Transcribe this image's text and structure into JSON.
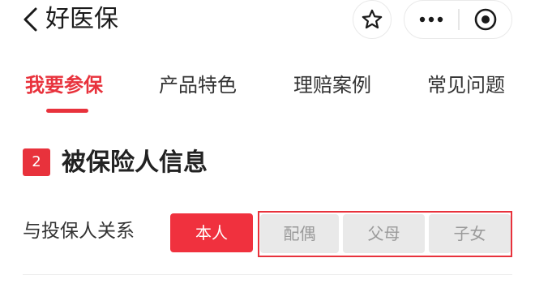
{
  "nav": {
    "title": "好医保",
    "icons": {
      "back": "chevron-left-icon",
      "favorite": "star-icon",
      "more": "more-dots-icon",
      "close": "target-circle-icon"
    }
  },
  "tabs": [
    {
      "label": "我要参保",
      "active": true
    },
    {
      "label": "产品特色",
      "active": false
    },
    {
      "label": "理赔案例",
      "active": false
    },
    {
      "label": "常见问题",
      "active": false
    }
  ],
  "section": {
    "step": "2",
    "title": "被保险人信息"
  },
  "relationship": {
    "label": "与投保人关系",
    "options": [
      {
        "label": "本人",
        "selected": true
      },
      {
        "label": "配偶",
        "selected": false
      },
      {
        "label": "父母",
        "selected": false
      },
      {
        "label": "子女",
        "selected": false
      }
    ]
  },
  "colors": {
    "accent": "#e8323c",
    "selected_bg": "#f0313e",
    "unselected_bg": "#e9e9e9",
    "unselected_text": "#9a9a9a"
  }
}
